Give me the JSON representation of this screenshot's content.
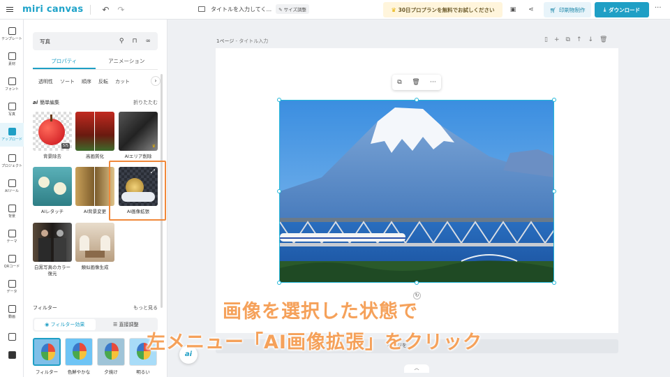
{
  "app": {
    "logo": "miri canvas",
    "doc_title": "タイトルを入力してく...",
    "size_adjust": "サイズ調整",
    "pro_banner": "30日プロプランを無料でお試しください",
    "print_label": "印刷物制作",
    "download_label": "ダウンロード"
  },
  "rail": [
    {
      "label": "テンプレート",
      "icon": "template-icon"
    },
    {
      "label": "素材",
      "icon": "elements-icon"
    },
    {
      "label": "フォント",
      "icon": "text-icon"
    },
    {
      "label": "写真",
      "icon": "photo-icon"
    },
    {
      "label": "アップロード",
      "icon": "upload-icon"
    },
    {
      "label": "プロジェクト",
      "icon": "project-icon"
    },
    {
      "label": "AIツール",
      "icon": "ai-tools-icon"
    },
    {
      "label": "背景",
      "icon": "background-icon"
    },
    {
      "label": "テーマ",
      "icon": "theme-icon"
    },
    {
      "label": "QRコード",
      "icon": "qr-icon"
    },
    {
      "label": "データ",
      "icon": "data-icon"
    },
    {
      "label": "動画",
      "icon": "video-icon"
    },
    {
      "label": "",
      "icon": "music-icon"
    },
    {
      "label": "",
      "icon": "shape-icon"
    }
  ],
  "panel": {
    "header": "写真",
    "tabs": [
      "プロパティ",
      "アニメーション"
    ],
    "subtabs": [
      "透明性",
      "ソート",
      "順序",
      "反転",
      "カット"
    ],
    "easy_edit_title": "簡単編集",
    "ai_mark": "ai",
    "collapse_label": "折りたたむ",
    "tools": [
      {
        "label": "背景除去",
        "badge": "5/5"
      },
      {
        "label": "高画質化"
      },
      {
        "label": "AIエリア削除"
      },
      {
        "label": "AIレタッチ"
      },
      {
        "label": "AI背景変更"
      },
      {
        "label": "AI画像拡張"
      },
      {
        "label": "白黒写真のカラー復元"
      },
      {
        "label": "類似画像生成"
      }
    ],
    "filter_title": "フィルター",
    "filter_more": "もっと見る",
    "filter_tabs": [
      "フィルター効果",
      "直接調整"
    ],
    "filters": [
      "フィルター",
      "色鮮やかな",
      "夕焼け",
      "明るい"
    ]
  },
  "canvas": {
    "page_number": "1ページ",
    "page_title": "タイトル入力",
    "bottom_text": "ページを"
  },
  "caption": {
    "line1": "画像を選択した状態で",
    "line2": "左メニュー「AI画像拡張」をクリック"
  },
  "colors": {
    "accent": "#1f9fc5",
    "highlight": "#f0883a",
    "caption": "#f5a15a"
  }
}
